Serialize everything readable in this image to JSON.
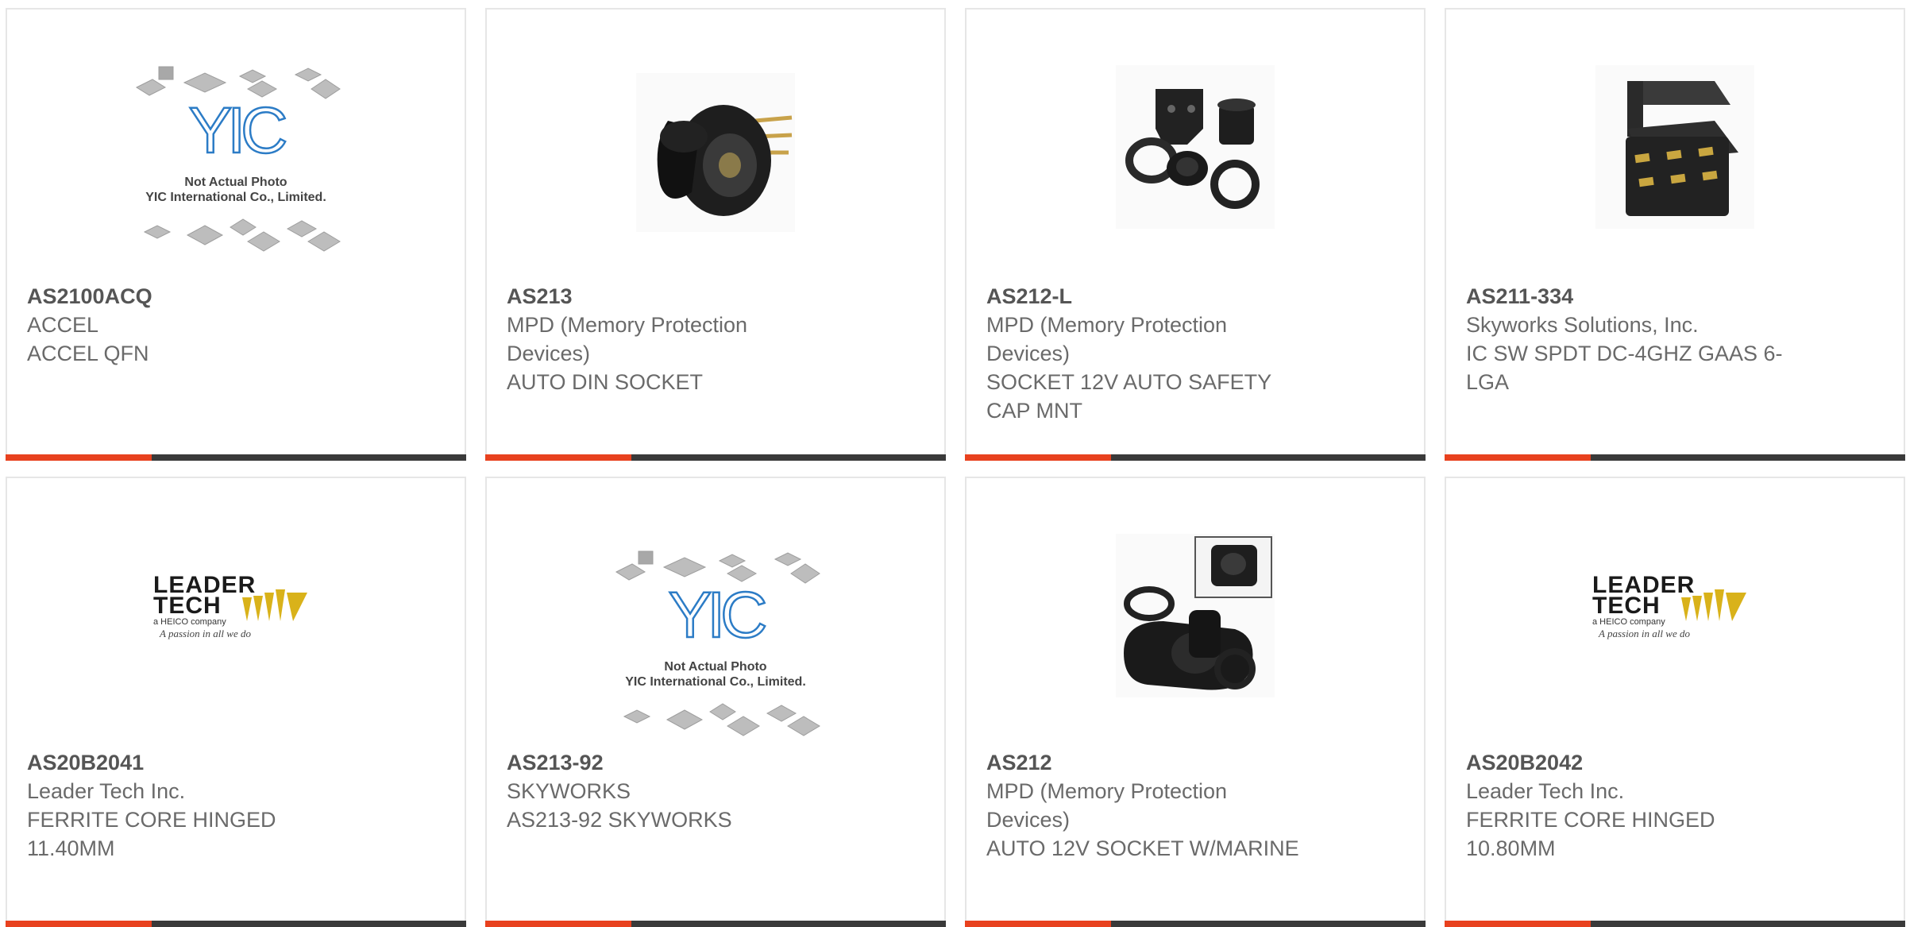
{
  "products": [
    {
      "part": "AS2100ACQ",
      "manufacturer": "ACCEL",
      "description": "ACCEL QFN",
      "image": "yic-placeholder"
    },
    {
      "part": "AS213",
      "manufacturer": "MPD (Memory Protection Devices)",
      "description": "AUTO DIN SOCKET",
      "image": "socket-cap-photo"
    },
    {
      "part": "AS212-L",
      "manufacturer": "MPD (Memory Protection Devices)",
      "description": "SOCKET 12V AUTO SAFETY CAP MNT",
      "image": "socket-kit-photo"
    },
    {
      "part": "AS211-334",
      "manufacturer": "Skyworks Solutions, Inc.",
      "description": "IC SW SPDT DC-4GHZ GAAS 6-LGA",
      "image": "lga-chip-photo"
    },
    {
      "part": "AS20B2041",
      "manufacturer": "Leader Tech Inc.",
      "description": "FERRITE CORE HINGED 11.40MM",
      "image": "leader-tech-logo"
    },
    {
      "part": "AS213-92",
      "manufacturer": "SKYWORKS",
      "description": "AS213-92 SKYWORKS",
      "image": "yic-placeholder"
    },
    {
      "part": "AS212",
      "manufacturer": "MPD (Memory Protection Devices)",
      "description": "AUTO 12V SOCKET W/MARINE",
      "image": "marine-socket-photo"
    },
    {
      "part": "AS20B2042",
      "manufacturer": "Leader Tech Inc.",
      "description": "FERRITE CORE HINGED 10.80MM",
      "image": "leader-tech-logo"
    }
  ],
  "placeholder": {
    "logo_text": "YIC",
    "line1": "Not Actual Photo",
    "line2": "YIC International Co., Limited."
  },
  "leader_logo": {
    "line1": "LEADER",
    "line2": "TECH",
    "tagline": "a HEICO company",
    "script": "A passion in all we do"
  },
  "colors": {
    "accent": "#e8411e",
    "bar": "#3a3a3a",
    "part_text": "#555555",
    "body_text": "#6a6a6a",
    "border": "#e6e6e6"
  }
}
